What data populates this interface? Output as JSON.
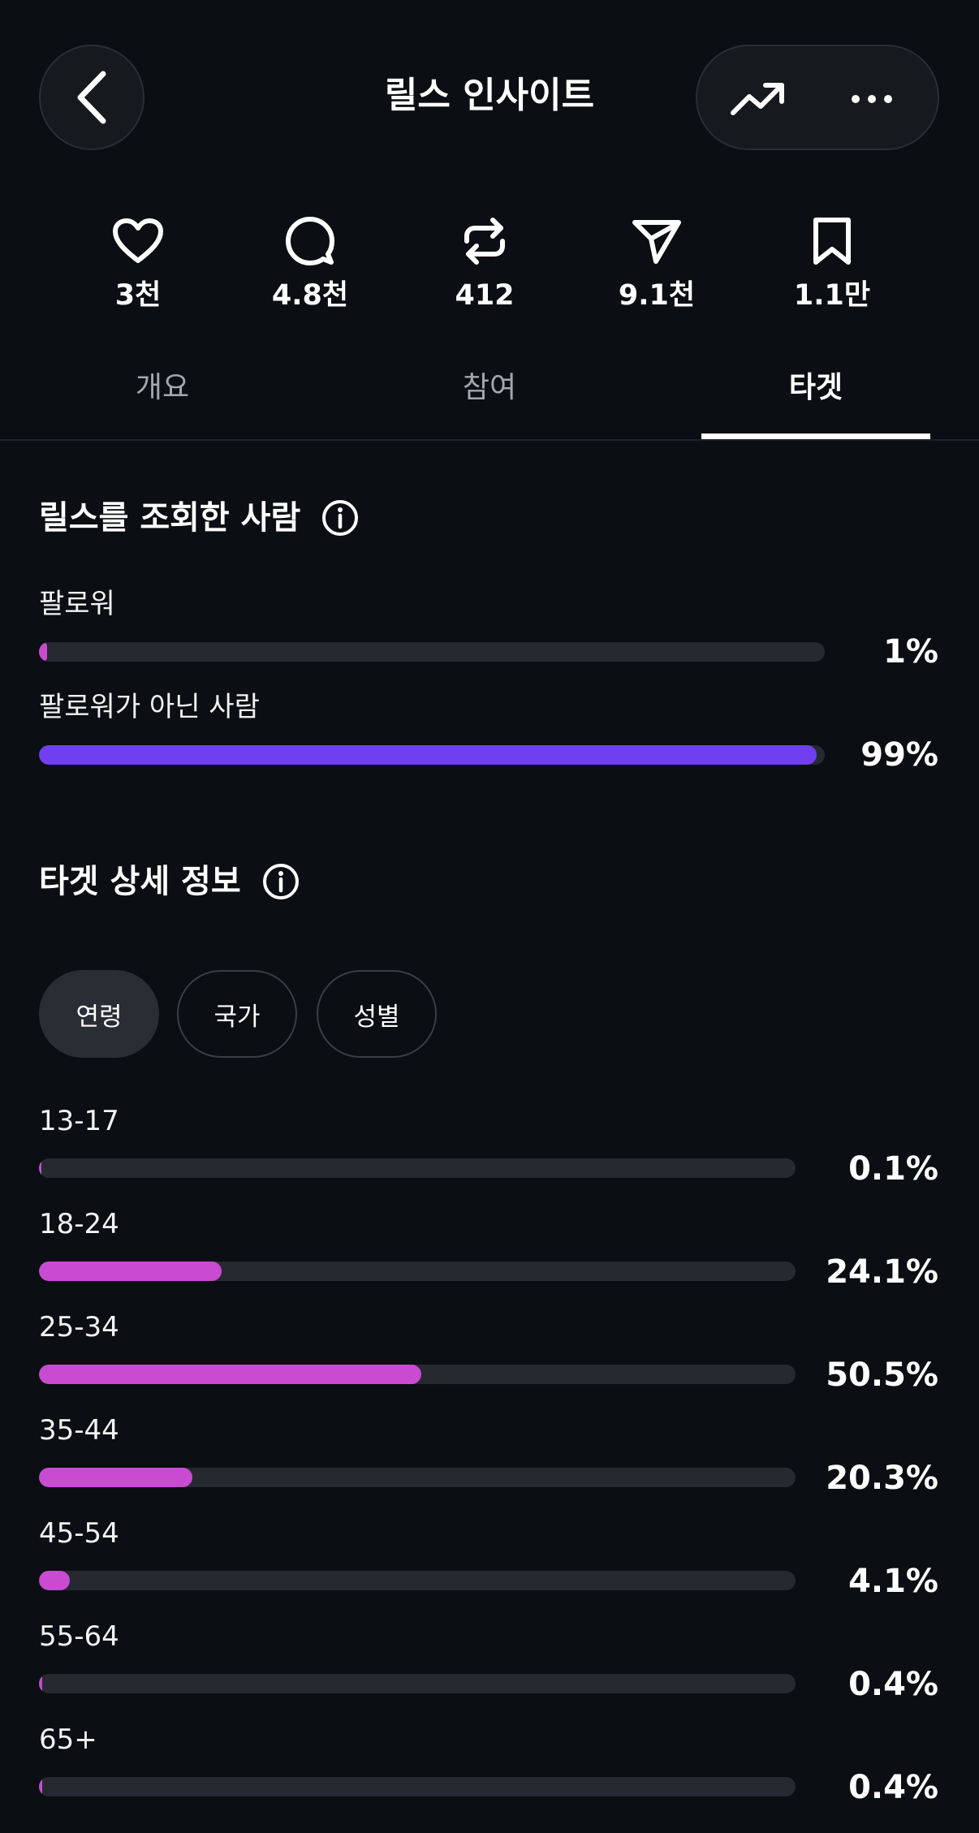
{
  "header": {
    "title": "릴스 인사이트",
    "back_icon": "chevron-left-icon",
    "trend_icon": "trending-up-icon",
    "more_icon": "more-horizontal-icon"
  },
  "stats": [
    {
      "icon": "heart-icon",
      "value": "3천"
    },
    {
      "icon": "comment-icon",
      "value": "4.8천"
    },
    {
      "icon": "repost-icon",
      "value": "412"
    },
    {
      "icon": "send-icon",
      "value": "9.1천"
    },
    {
      "icon": "bookmark-icon",
      "value": "1.1만"
    }
  ],
  "tabs": [
    {
      "label": "개요",
      "active": false
    },
    {
      "label": "참여",
      "active": false
    },
    {
      "label": "타겟",
      "active": true
    }
  ],
  "viewers": {
    "title": "릴스를 조회한 사람",
    "rows": [
      {
        "label": "팔로워",
        "value": 1,
        "display": "1%",
        "color": "#c94bd1"
      },
      {
        "label": "팔로워가 아닌 사람",
        "value": 99,
        "display": "99%",
        "color": "#7040f0"
      }
    ]
  },
  "details": {
    "title": "타겟 상세 정보",
    "chips": [
      {
        "label": "연령",
        "selected": true
      },
      {
        "label": "국가",
        "selected": false
      },
      {
        "label": "성별",
        "selected": false
      }
    ],
    "bar_color": "#c94bd1",
    "age_rows": [
      {
        "label": "13-17",
        "value": 0.1,
        "display": "0.1%"
      },
      {
        "label": "18-24",
        "value": 24.1,
        "display": "24.1%"
      },
      {
        "label": "25-34",
        "value": 50.5,
        "display": "50.5%"
      },
      {
        "label": "35-44",
        "value": 20.3,
        "display": "20.3%"
      },
      {
        "label": "45-54",
        "value": 4.1,
        "display": "4.1%"
      },
      {
        "label": "55-64",
        "value": 0.4,
        "display": "0.4%"
      },
      {
        "label": "65+",
        "value": 0.4,
        "display": "0.4%"
      }
    ]
  }
}
